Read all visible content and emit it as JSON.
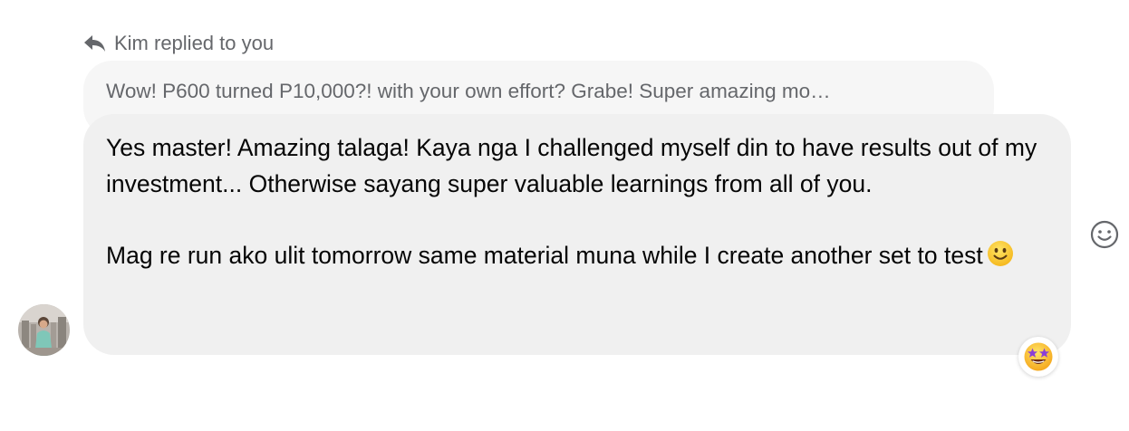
{
  "reply_header": {
    "text": "Kim replied to you",
    "icon": "reply-arrow-icon"
  },
  "quoted_message": {
    "text": "Wow! P600 turned P10,000?! with your own effort? Grabe! Super amazing mo…"
  },
  "message": {
    "paragraph_1": "Yes master! Amazing talaga!  Kaya nga I challenged myself din to have results out of my investment... Otherwise sayang super valuable learnings from all of you.",
    "paragraph_2": "Mag re run ako ulit tomorrow same material muna while I create another set to test",
    "inline_emoji": "slightly-smiling-face"
  },
  "reaction": {
    "emoji": "star-struck"
  },
  "react_button": {
    "icon": "smiley-outline-icon"
  },
  "colors": {
    "bubble_bg": "#f0f0f0",
    "quoted_bg": "#f6f6f6",
    "secondary_text": "#65676b",
    "primary_text": "#050505"
  }
}
